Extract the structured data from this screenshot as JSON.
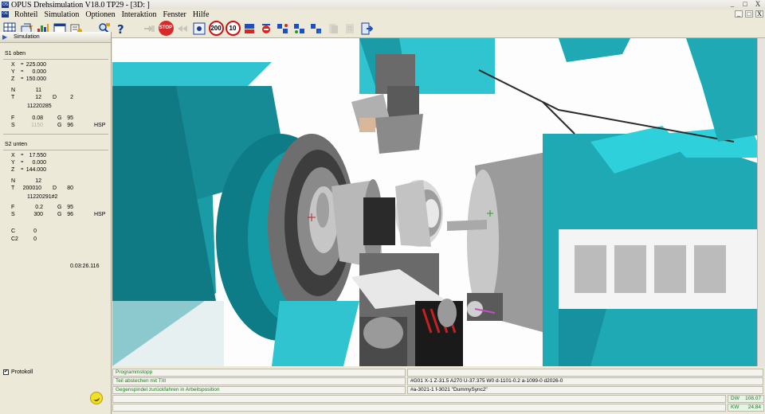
{
  "window": {
    "title": "OPUS Drehsimulation V18.0  TP29  - [3D: ]",
    "app_icon": "OS",
    "buttons": [
      "_",
      "□",
      "X"
    ]
  },
  "menu": {
    "items": [
      "Rohteil",
      "Simulation",
      "Optionen",
      "Interaktion",
      "Fenster",
      "Hilfe"
    ],
    "mdi_buttons": [
      "_",
      "□",
      "X"
    ]
  },
  "toolbar": {
    "icons": [
      "grid-icon",
      "export-icon",
      "chart-icon",
      "window-icon",
      "settings-icon",
      "magnify-icon",
      "help-icon",
      "cursor-icon",
      "stop-icon",
      "rewind-icon",
      "tool-view-icon",
      "speed-200-icon",
      "speed-10-icon",
      "step-icon",
      "probe-icon",
      "channel1-icon",
      "channel2-icon",
      "channel3-icon",
      "copy-icon",
      "paste-icon",
      "exit-icon"
    ],
    "stop_label": "STOP",
    "speed_200": "200",
    "speed_10": "10"
  },
  "panel": {
    "title": "Simulation",
    "s1": {
      "title": "S1 oben",
      "x": "225.000",
      "y": "0.000",
      "z": "150.000",
      "n": "11",
      "t": "12",
      "d": "2",
      "t_id": "11220285",
      "f": "0.08",
      "g1": "95",
      "s": "1150",
      "g2": "96",
      "hsp": "HSP"
    },
    "s2": {
      "title": "S2 unten",
      "x": "17.550",
      "y": "0.000",
      "z": "144.000",
      "n": "12",
      "t": "200010",
      "d": "80",
      "t_id": "11220291#2",
      "f": "0.2",
      "g1": "95",
      "s": "300",
      "g2": "96",
      "hsp": "HSP"
    },
    "c": "0",
    "c2": "0",
    "time": "0.03:26.116",
    "protokoll_label": "Protokoll",
    "protokoll_checked": "✔"
  },
  "status": {
    "line1_left": "Programmstopp",
    "line2_left": "Teil abstechen mit TIII",
    "line2_right": "#G01 X-1 Z-31.5 A270 U-37.375 W0 d-1101-0.2 a-1099-0 d2026-0",
    "line3_left": "Gegenspindel zurückfahren in Arbeitsposition",
    "line3_right": "#a-3021-1 f-3021 \"DummySync2\"",
    "dw1_label": "DW",
    "dw1_value": "108.07",
    "dw2_label": "KW",
    "dw2_value": "24.84"
  },
  "colors": {
    "machine_teal": "#1ea9b5",
    "steel": "#9a9a9a",
    "background": "#ece9d8"
  }
}
